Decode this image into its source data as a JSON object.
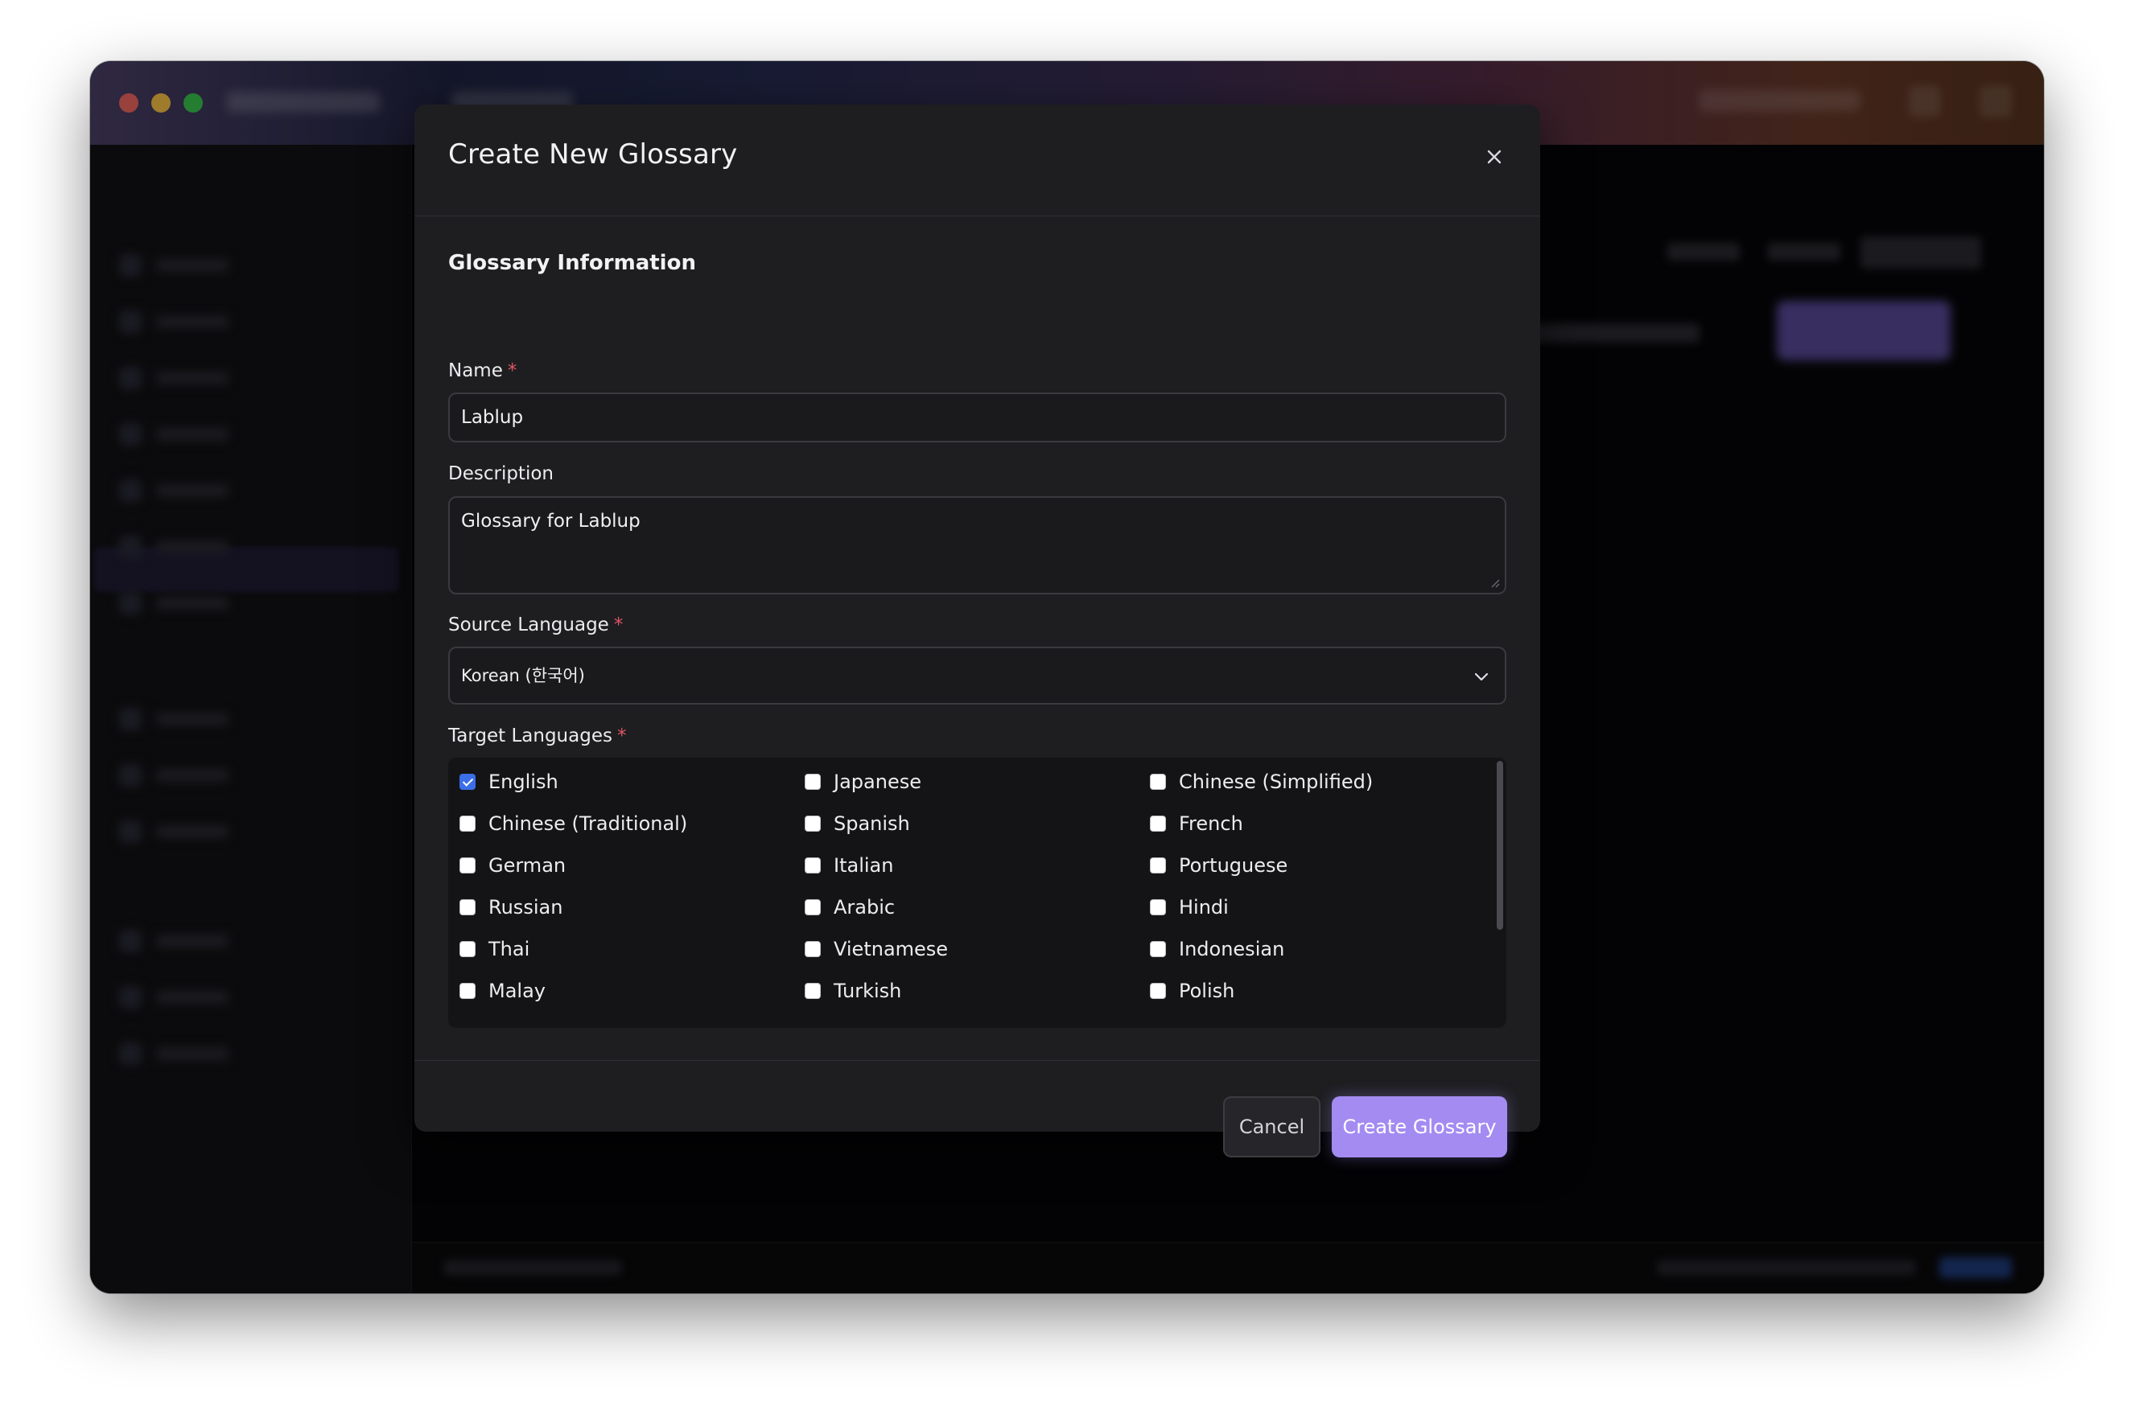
{
  "modal": {
    "title": "Create New Glossary",
    "section_title": "Glossary Information",
    "fields": {
      "name": {
        "label": "Name",
        "required_mark": "*",
        "value": "Lablup"
      },
      "description": {
        "label": "Description",
        "value": "Glossary for Lablup"
      },
      "source_language": {
        "label": "Source Language",
        "required_mark": "*",
        "value": "Korean (한국어)"
      },
      "target_languages": {
        "label": "Target Languages",
        "required_mark": "*",
        "options": [
          {
            "label": "English",
            "checked": true
          },
          {
            "label": "Japanese",
            "checked": false
          },
          {
            "label": "Chinese (Simplified)",
            "checked": false
          },
          {
            "label": "Chinese (Traditional)",
            "checked": false
          },
          {
            "label": "Spanish",
            "checked": false
          },
          {
            "label": "French",
            "checked": false
          },
          {
            "label": "German",
            "checked": false
          },
          {
            "label": "Italian",
            "checked": false
          },
          {
            "label": "Portuguese",
            "checked": false
          },
          {
            "label": "Russian",
            "checked": false
          },
          {
            "label": "Arabic",
            "checked": false
          },
          {
            "label": "Hindi",
            "checked": false
          },
          {
            "label": "Thai",
            "checked": false
          },
          {
            "label": "Vietnamese",
            "checked": false
          },
          {
            "label": "Indonesian",
            "checked": false
          },
          {
            "label": "Malay",
            "checked": false
          },
          {
            "label": "Turkish",
            "checked": false
          },
          {
            "label": "Polish",
            "checked": false
          }
        ]
      }
    },
    "buttons": {
      "cancel": "Cancel",
      "create": "Create Glossary"
    }
  },
  "colors": {
    "accent": "#a38bf2",
    "checkbox_checked": "#3b6ee8",
    "required": "#e05563",
    "modal_bg": "#1e1e21"
  },
  "icons": {
    "close": "close-icon",
    "dropdown": "chevron-down-icon"
  }
}
